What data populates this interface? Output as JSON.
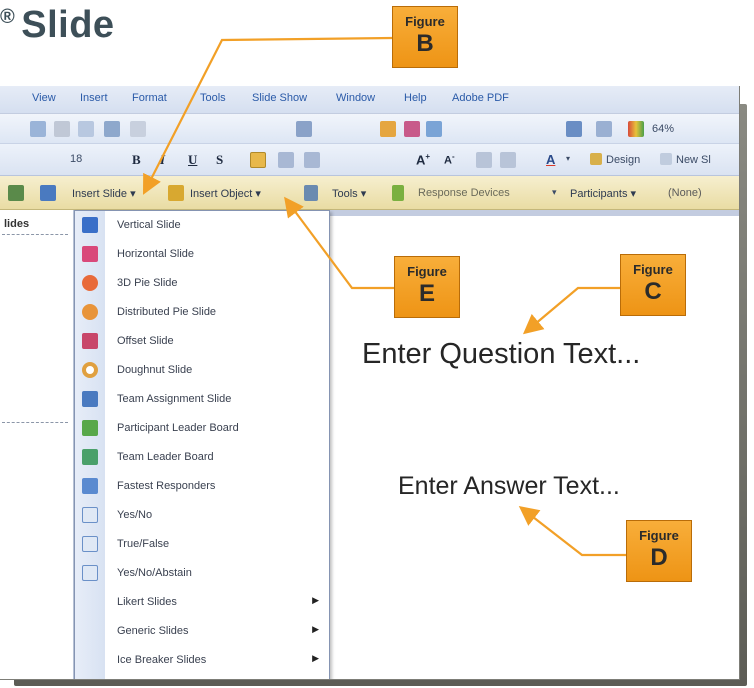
{
  "document": {
    "title": "Slide",
    "reg_mark": "®"
  },
  "menubar": {
    "items": [
      "View",
      "Insert",
      "Format",
      "Tools",
      "Slide Show",
      "Window",
      "Help",
      "Adobe PDF"
    ]
  },
  "toolbar1": {
    "zoom": "64%"
  },
  "toolbar2": {
    "font_size": "18",
    "design_label": "Design",
    "new_slide_label": "New Sl"
  },
  "turning_toolbar": {
    "insert_slide": "Insert Slide ▾",
    "insert_object": "Insert Object ▾",
    "tools": "Tools ▾",
    "response_devices": "Response Devices",
    "participants": "Participants ▾",
    "participants_value": "(None)"
  },
  "slides_pane": {
    "tab_label": "lides"
  },
  "insert_slide_menu": {
    "items": [
      {
        "label": "Vertical Slide",
        "icon": "vertical-bar-chart-icon",
        "color": "#3a6fc8",
        "submenu": false
      },
      {
        "label": "Horizontal Slide",
        "icon": "horizontal-bar-chart-icon",
        "color": "#d9487a",
        "submenu": false
      },
      {
        "label": "3D Pie Slide",
        "icon": "pie-3d-chart-icon",
        "color": "#e86a3a",
        "submenu": false
      },
      {
        "label": "Distributed Pie Slide",
        "icon": "distributed-pie-chart-icon",
        "color": "#e8943a",
        "submenu": false
      },
      {
        "label": "Offset Slide",
        "icon": "offset-chart-icon",
        "color": "#c8466a",
        "submenu": false
      },
      {
        "label": "Doughnut Slide",
        "icon": "doughnut-chart-icon",
        "color": "#e0a040",
        "submenu": false
      },
      {
        "label": "Team Assignment Slide",
        "icon": "team-assignment-icon",
        "color": "#4a7ac0",
        "submenu": false
      },
      {
        "label": "Participant Leader Board",
        "icon": "participant-leader-board-icon",
        "color": "#58a84a",
        "submenu": false
      },
      {
        "label": "Team Leader Board",
        "icon": "team-leader-board-icon",
        "color": "#4aa06a",
        "submenu": false
      },
      {
        "label": "Fastest Responders",
        "icon": "fastest-responders-icon",
        "color": "#5a8ad0",
        "submenu": false
      },
      {
        "label": "Yes/No",
        "icon": "yes-no-icon",
        "color": "#6a90c8",
        "submenu": false
      },
      {
        "label": "True/False",
        "icon": "true-false-icon",
        "color": "#6a90c8",
        "submenu": false
      },
      {
        "label": "Yes/No/Abstain",
        "icon": "yes-no-abstain-icon",
        "color": "#6a90c8",
        "submenu": false
      },
      {
        "label": "Likert Slides",
        "icon": "",
        "color": "",
        "submenu": true
      },
      {
        "label": "Generic Slides",
        "icon": "",
        "color": "",
        "submenu": true
      },
      {
        "label": "Ice Breaker Slides",
        "icon": "",
        "color": "",
        "submenu": true
      }
    ]
  },
  "slide_canvas": {
    "question_text": "Enter Question Text...",
    "answer_text": "Enter Answer Text..."
  },
  "callouts": [
    {
      "id": "B",
      "word": "Figure",
      "letter": "B"
    },
    {
      "id": "E",
      "word": "Figure",
      "letter": "E"
    },
    {
      "id": "C",
      "word": "Figure",
      "letter": "C"
    },
    {
      "id": "D",
      "word": "Figure",
      "letter": "D"
    }
  ],
  "colors": {
    "callout_fill": "#f2a027",
    "arrow": "#f2a027",
    "turning_toolbar": "#ece1b0",
    "menu_text": "#2a5aa8"
  }
}
